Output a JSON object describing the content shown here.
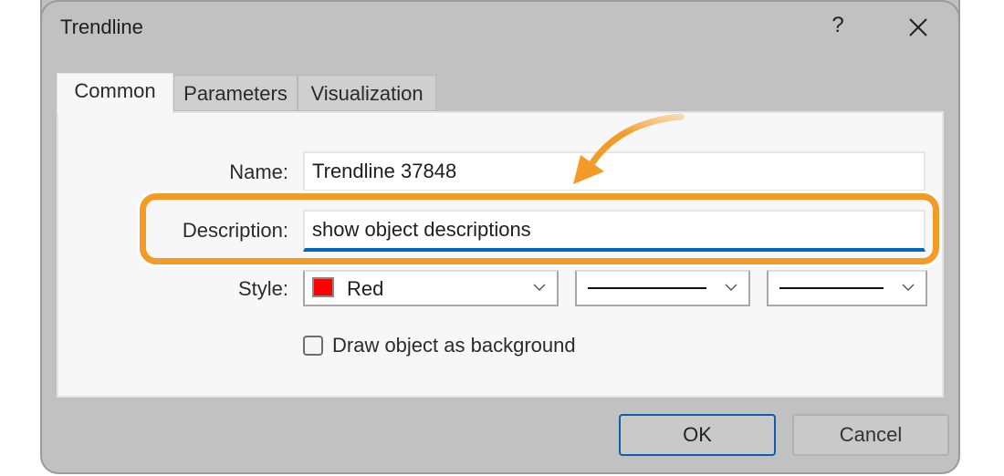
{
  "dialog": {
    "title": "Trendline",
    "help_label": "?",
    "close_icon": "close-icon"
  },
  "tabs": [
    {
      "label": "Common",
      "active": true
    },
    {
      "label": "Parameters",
      "active": false
    },
    {
      "label": "Visualization",
      "active": false
    }
  ],
  "form": {
    "name_label": "Name:",
    "name_value": "Trendline 37848",
    "description_label": "Description:",
    "description_value": "show object descriptions",
    "style_label": "Style:",
    "color_value": "Red",
    "color_hex": "#ff0000",
    "line_style_value": "solid",
    "line_width_value": "solid",
    "background_checkbox_label": "Draw object as background",
    "background_checked": false
  },
  "buttons": {
    "ok": "OK",
    "cancel": "Cancel"
  },
  "annotation": {
    "highlight_color": "#f39b26",
    "target": "description-field"
  }
}
